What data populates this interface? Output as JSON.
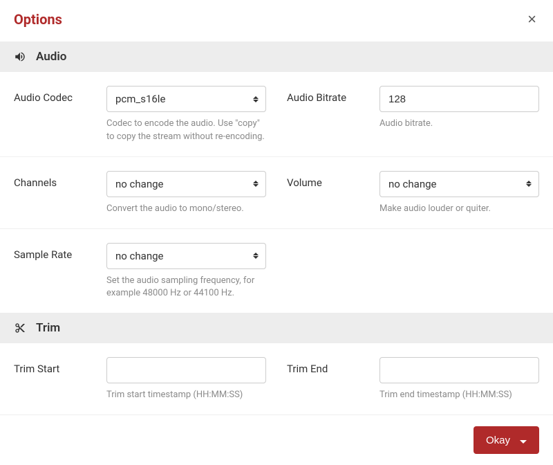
{
  "modal": {
    "title": "Options"
  },
  "sections": {
    "audio": {
      "title": "Audio",
      "fields": {
        "codec": {
          "label": "Audio Codec",
          "value": "pcm_s16le",
          "help": "Codec to encode the audio. Use \"copy\" to copy the stream without re-encoding."
        },
        "bitrate": {
          "label": "Audio Bitrate",
          "value": "128",
          "help": "Audio bitrate."
        },
        "channels": {
          "label": "Channels",
          "value": "no change",
          "help": "Convert the audio to mono/stereo."
        },
        "volume": {
          "label": "Volume",
          "value": "no change",
          "help": "Make audio louder or quiter."
        },
        "sample_rate": {
          "label": "Sample Rate",
          "value": "no change",
          "help": "Set the audio sampling frequency, for example 48000 Hz or 44100 Hz."
        }
      }
    },
    "trim": {
      "title": "Trim",
      "fields": {
        "start": {
          "label": "Trim Start",
          "value": "",
          "help": "Trim start timestamp (HH:MM:SS)"
        },
        "end": {
          "label": "Trim End",
          "value": "",
          "help": "Trim end timestamp (HH:MM:SS)"
        }
      }
    }
  },
  "footer": {
    "okay_label": "Okay"
  }
}
